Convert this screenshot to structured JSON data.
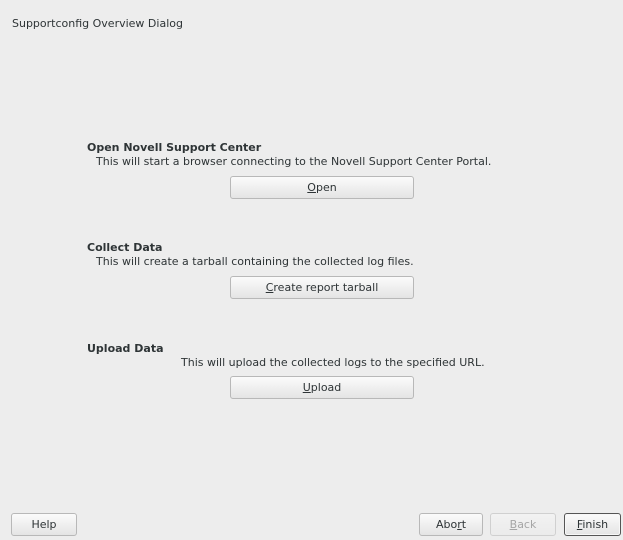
{
  "window": {
    "title": "Supportconfig Overview Dialog"
  },
  "sections": [
    {
      "title": "Open Novell Support Center",
      "description": "This will start a browser connecting to the Novell Support Center Portal.",
      "button": {
        "pre": "",
        "mnemonic": "O",
        "post": "pen"
      }
    },
    {
      "title": "Collect Data",
      "description": "This will create a tarball containing the collected log files.",
      "button": {
        "pre": "",
        "mnemonic": "C",
        "post": "reate report tarball"
      }
    },
    {
      "title": "Upload Data",
      "description": "This will upload the collected logs to the specified URL.",
      "button": {
        "pre": "",
        "mnemonic": "U",
        "post": "pload"
      }
    }
  ],
  "footer": {
    "help": "Help",
    "abort": {
      "pre": "Abo",
      "mnemonic": "r",
      "post": "t"
    },
    "back": {
      "pre": "",
      "mnemonic": "B",
      "post": "ack"
    },
    "finish": {
      "pre": "",
      "mnemonic": "F",
      "post": "inish"
    }
  }
}
